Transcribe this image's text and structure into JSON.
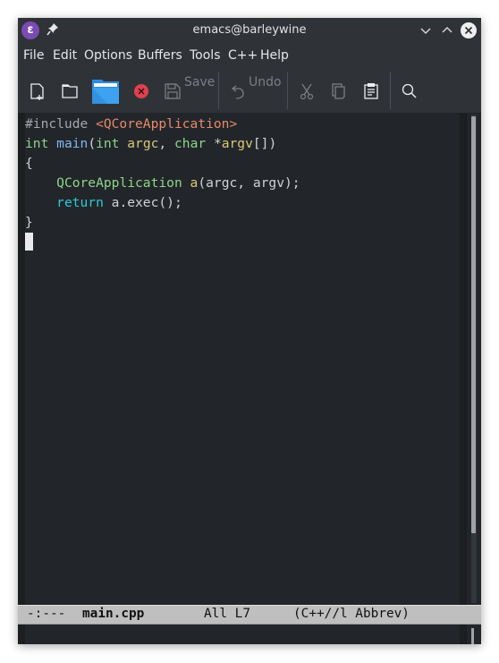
{
  "window": {
    "title": "emacs@barleywine",
    "app_icon": "emacs-icon",
    "controls": [
      "minimize-icon",
      "maximize-icon",
      "close-icon"
    ]
  },
  "menubar": {
    "items": [
      "File",
      "Edit",
      "Options",
      "Buffers",
      "Tools",
      "C++",
      "Help"
    ]
  },
  "toolbar": {
    "new_file": "new-file-icon",
    "open_file": "open-folder-icon",
    "dired": "folder-icon",
    "kill_buffer": "close-circle-icon",
    "save_label": "Save",
    "undo_label": "Undo",
    "cut": "scissors-icon",
    "copy": "copy-icon",
    "paste": "clipboard-icon",
    "search": "search-icon"
  },
  "editor": {
    "lines": [
      [
        {
          "t": "#include ",
          "c": "pre"
        },
        {
          "t": "<QCoreApplication>",
          "c": "str"
        }
      ],
      [
        {
          "t": "int",
          "c": "type"
        },
        {
          "t": " ",
          "c": "punc"
        },
        {
          "t": "main",
          "c": "fn"
        },
        {
          "t": "(",
          "c": "punc"
        },
        {
          "t": "int",
          "c": "type"
        },
        {
          "t": " ",
          "c": "punc"
        },
        {
          "t": "argc",
          "c": "var"
        },
        {
          "t": ", ",
          "c": "punc"
        },
        {
          "t": "char",
          "c": "type"
        },
        {
          "t": " *",
          "c": "punc"
        },
        {
          "t": "argv",
          "c": "var"
        },
        {
          "t": "[])",
          "c": "punc"
        }
      ],
      [
        {
          "t": "{",
          "c": "punc"
        }
      ],
      [
        {
          "t": "    ",
          "c": "punc"
        },
        {
          "t": "QCoreApplication",
          "c": "type"
        },
        {
          "t": " ",
          "c": "punc"
        },
        {
          "t": "a",
          "c": "var"
        },
        {
          "t": "(argc, argv);",
          "c": "punc"
        }
      ],
      [
        {
          "t": "    ",
          "c": "punc"
        },
        {
          "t": "return",
          "c": "kw"
        },
        {
          "t": " a.exec();",
          "c": "punc"
        }
      ],
      [
        {
          "t": "}",
          "c": "punc"
        }
      ]
    ],
    "cursor_line": 7
  },
  "modeline": {
    "status": "-:---",
    "buffer_name": "main.cpp",
    "position": "All L7",
    "modes": "(C++//l Abbrev)"
  },
  "colors": {
    "accent_emacs": "#7b4bb3",
    "kill_red": "#e0404f",
    "folder_blue": "#2f8fe0"
  }
}
